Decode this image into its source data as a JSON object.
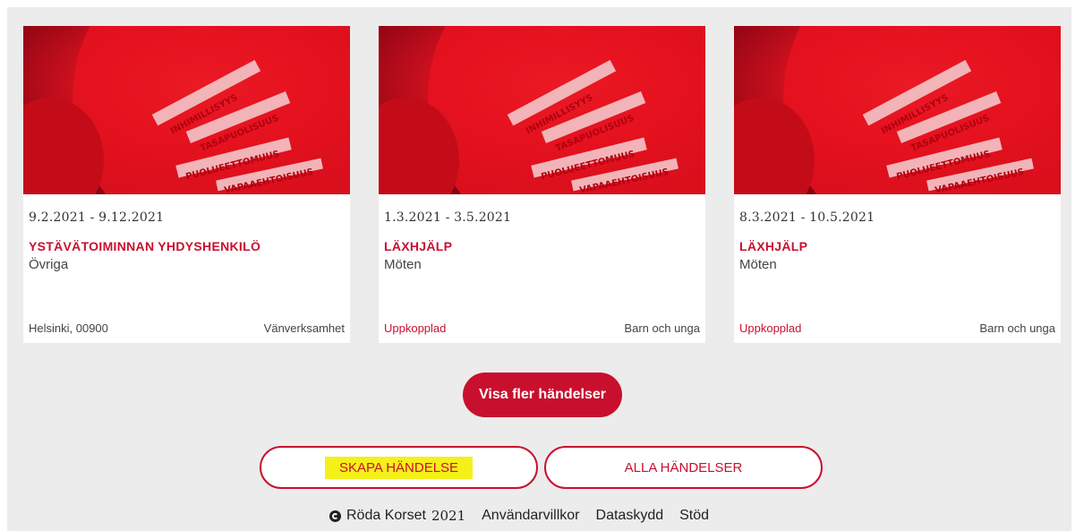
{
  "events": [
    {
      "date": "9.2.2021 - 9.12.2021",
      "title": "YSTÄVÄTOIMINNAN YHDYSHENKILÖ",
      "category": "Övriga",
      "location": "Helsinki, 00900",
      "tag": "Vänverksamhet"
    },
    {
      "date": "1.3.2021 - 3.5.2021",
      "title": "LÄXHJÄLP",
      "category": "Möten",
      "location": "Uppkopplad",
      "tag": "Barn och unga"
    },
    {
      "date": "8.3.2021 - 10.5.2021",
      "title": "LÄXHJÄLP",
      "category": "Möten",
      "location": "Uppkopplad",
      "tag": "Barn och unga"
    }
  ],
  "image_banner_words": [
    "INHIMILLISYYS",
    "TASAPUOLISUUS",
    "PUOLUEETTOMUUS",
    "VAPAAEHTOISUUS"
  ],
  "buttons": {
    "show_more": "Visa fler händelser",
    "create_event": "SKAPA HÄNDELSE",
    "all_events": "ALLA HÄNDELSER"
  },
  "footer": {
    "copyright_name": "Röda Korset",
    "copyright_year": "2021",
    "links": [
      "Användarvillkor",
      "Dataskydd",
      "Stöd"
    ]
  },
  "colors": {
    "accent": "#c8102e",
    "highlight": "#f5f01a",
    "panel_bg": "#ececec"
  }
}
